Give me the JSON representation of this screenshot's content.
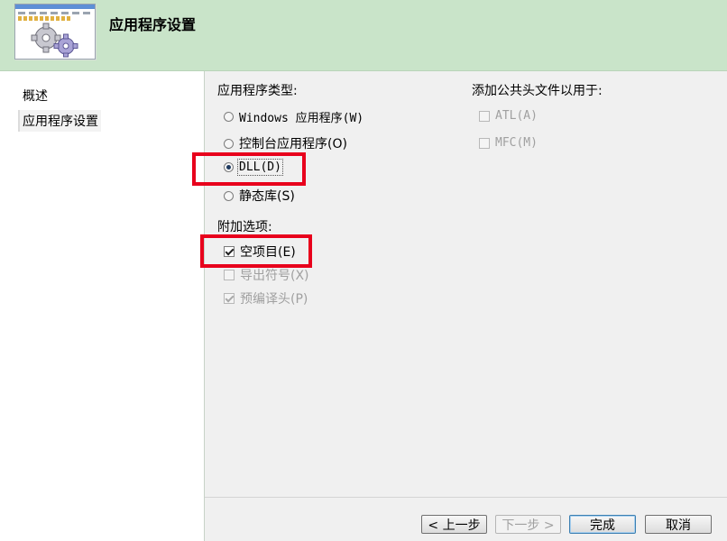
{
  "header": {
    "title": "应用程序设置",
    "icon": "gears-wizard-icon"
  },
  "nav": {
    "items": [
      {
        "label": "概述",
        "active": false
      },
      {
        "label": "应用程序设置",
        "active": true
      }
    ]
  },
  "app_type": {
    "label": "应用程序类型:",
    "options": [
      {
        "label": "Windows 应用程序(W)",
        "checked": false
      },
      {
        "label": "控制台应用程序(O)",
        "checked": false
      },
      {
        "label": "DLL(D)",
        "checked": true
      },
      {
        "label": "静态库(S)",
        "checked": false
      }
    ]
  },
  "headers": {
    "label": "添加公共头文件以用于:",
    "options": [
      {
        "label": "ATL(A)",
        "checked": false,
        "disabled": true
      },
      {
        "label": "MFC(M)",
        "checked": false,
        "disabled": true
      }
    ]
  },
  "extra": {
    "label": "附加选项:",
    "options": [
      {
        "label": "空项目(E)",
        "checked": true,
        "disabled": false
      },
      {
        "label": "导出符号(X)",
        "checked": false,
        "disabled": true
      },
      {
        "label": "预编译头(P)",
        "checked": true,
        "disabled": true
      }
    ]
  },
  "buttons": {
    "prev": "< 上一步",
    "next": "下一步 >",
    "finish": "完成",
    "cancel": "取消"
  },
  "colors": {
    "header_bg": "#c9e4c9",
    "highlight": "#e8001c"
  }
}
